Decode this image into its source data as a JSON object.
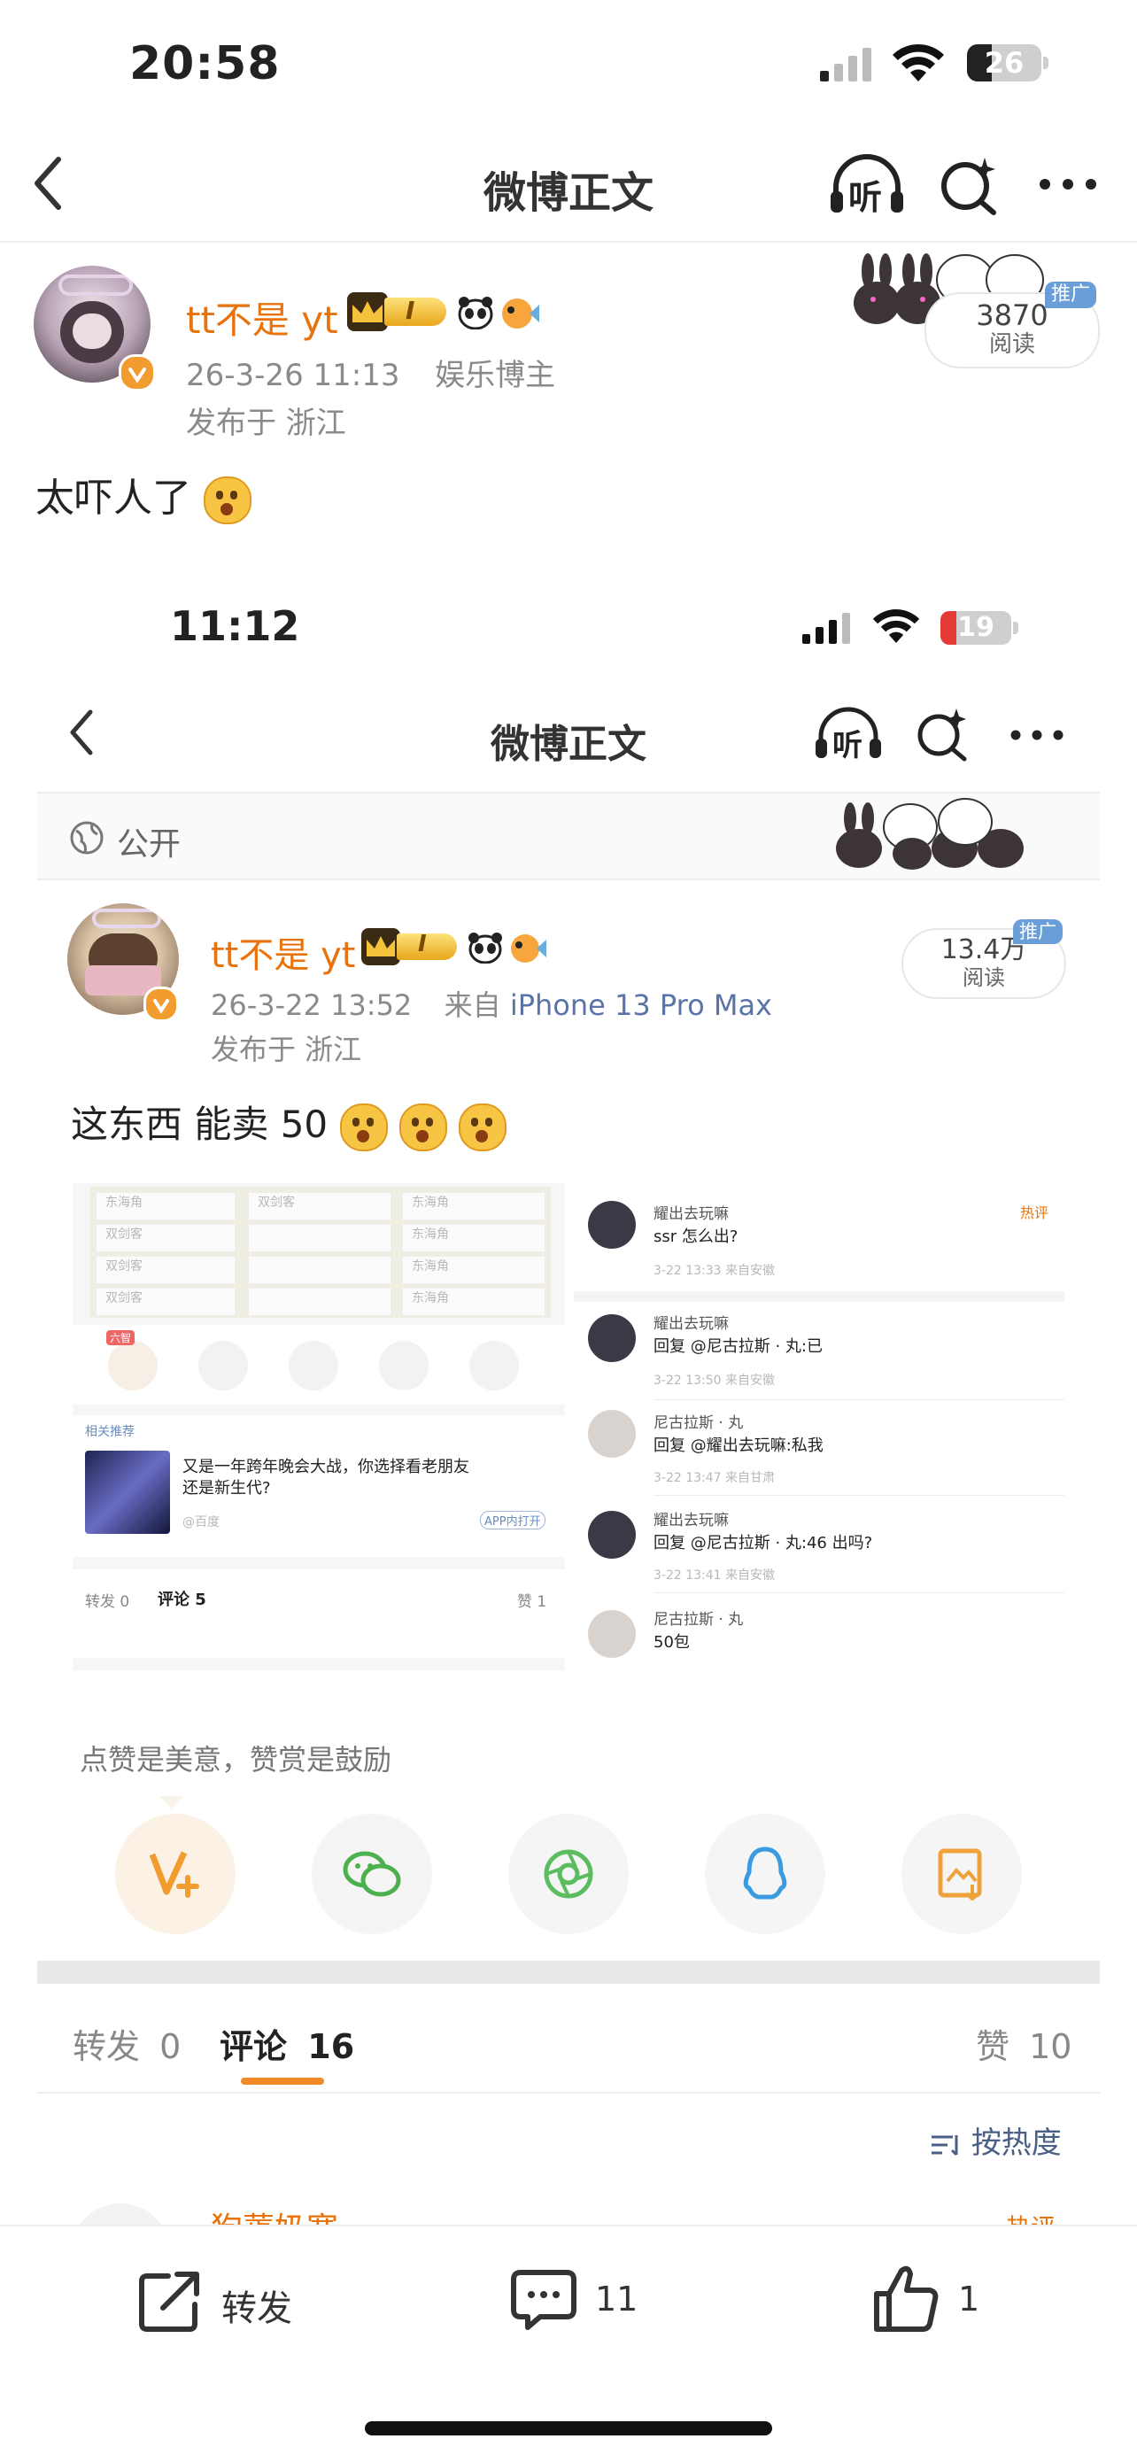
{
  "status_bar": {
    "time": "20:58",
    "battery": "26"
  },
  "nav": {
    "title": "微博正文",
    "listen": "听"
  },
  "post": {
    "username": "tt不是 yt",
    "level_badge": "I",
    "date": "26-3-26 11:13",
    "role": "娱乐博主",
    "location": "发布于 浙江",
    "read_count": "3870",
    "read_label": "阅读",
    "ad_label": "推广",
    "text": "太吓人了"
  },
  "embedded": {
    "status_time": "11:12",
    "battery": "19",
    "nav_title": "微博正文",
    "listen": "听",
    "visibility": "公开",
    "username": "tt不是 yt",
    "level_badge": "I",
    "date": "26-3-22 13:52",
    "source_prefix": "来自",
    "source": "iPhone 13 Pro Max",
    "location": "发布于 浙江",
    "read_count": "13.4万",
    "read_label": "阅读",
    "ad_label": "推广",
    "text": "这东西 能卖 50",
    "inner_left": {
      "tag": "六智",
      "related_label": "相关推荐",
      "related_text_1": "又是一年跨年晚会大战，你选择看老朋友",
      "related_text_2": "还是新生代?",
      "related_source": "@百度",
      "related_open": "APP内打开",
      "tab_repost": "转发 0",
      "tab_comment": "评论 5",
      "tab_like": "赞 1",
      "grid_labels": [
        "东海角",
        "双剑客",
        "双剑客",
        "双剑客",
        "双剑客",
        "东海角",
        "东海角",
        "东海角",
        "东海角"
      ]
    },
    "inner_right": {
      "hot_label": "热评",
      "comments": [
        {
          "name": "耀出去玩嘛",
          "text": "ssr 怎么出?",
          "meta": "3-22 13:33  来自安徽"
        },
        {
          "name": "耀出去玩嘛",
          "text": "回复 @尼古拉斯 · 丸:已",
          "meta": "3-22 13:50  来自安徽"
        },
        {
          "name": "尼古拉斯 · 丸",
          "text": "回复 @耀出去玩嘛:私我",
          "meta": "3-22 13:47  来自甘肃"
        },
        {
          "name": "耀出去玩嘛",
          "text": "回复 @尼古拉斯 · 丸:46 出吗?",
          "meta": "3-22 13:41  来自安徽"
        },
        {
          "name": "尼古拉斯 · 丸",
          "text": "50包",
          "meta": ""
        }
      ]
    },
    "like_hint": "点赞是美意，赞赏是鼓励",
    "tabs": {
      "repost": "转发",
      "repost_count": "0",
      "comment": "评论",
      "comment_count": "16",
      "like": "赞",
      "like_count": "10"
    },
    "sort_label": "按热度",
    "partial_comment_name": "狗蔫奶寒",
    "partial_hot": "热评"
  },
  "bottom_bar": {
    "repost": "转发",
    "comment_count": "11",
    "like_count": "1"
  }
}
